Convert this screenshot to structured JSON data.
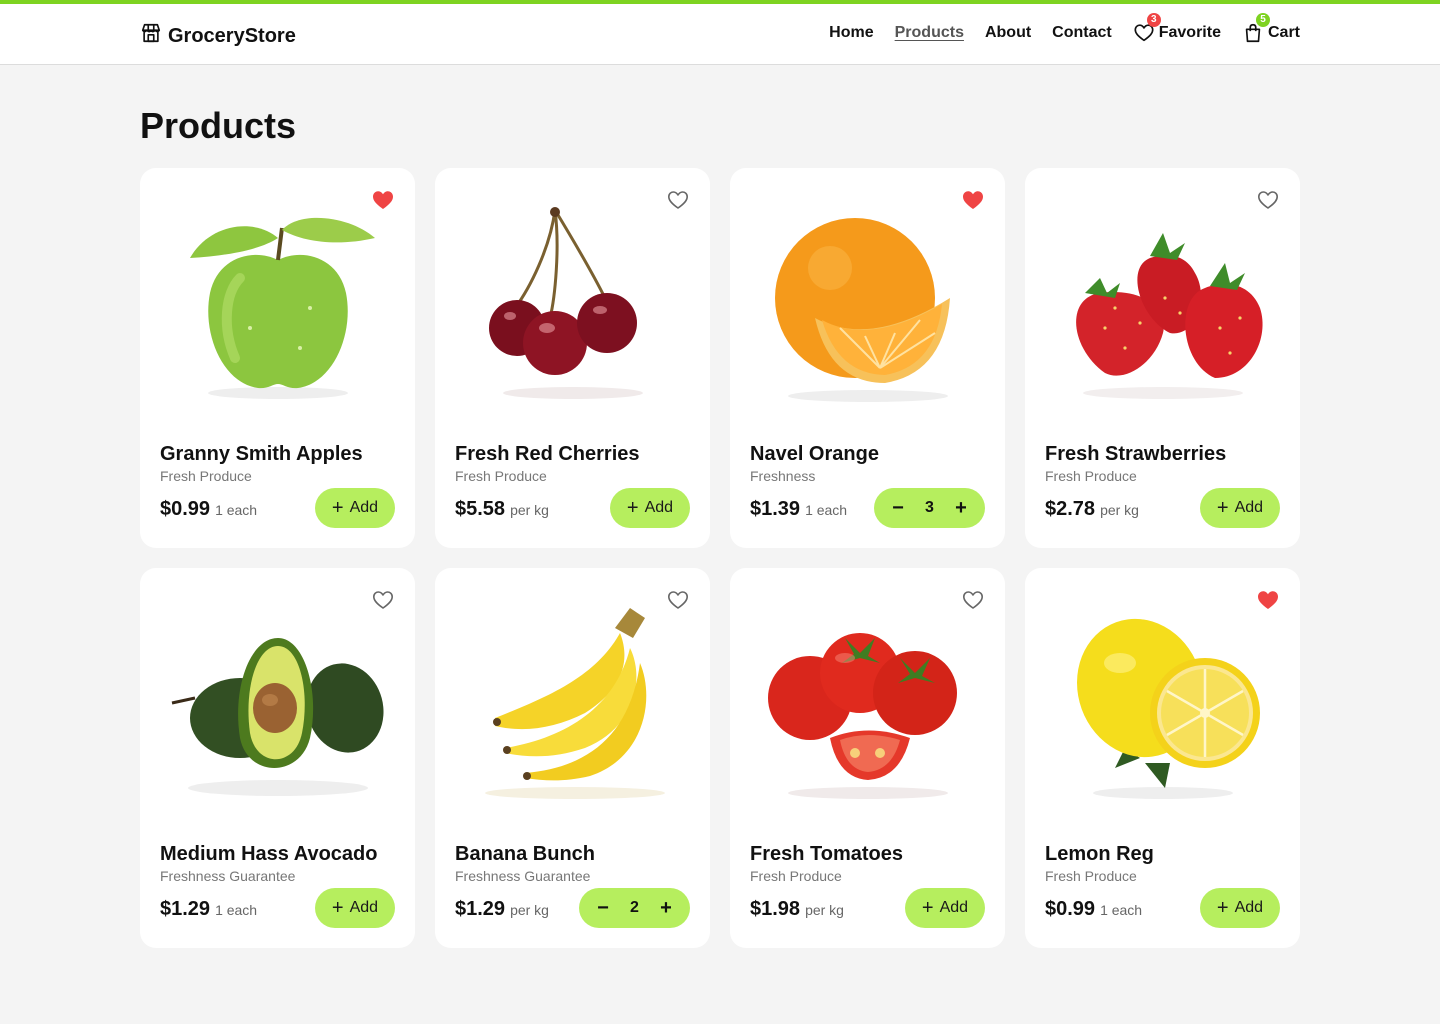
{
  "brand": {
    "name": "GroceryStore",
    "icon": "store-icon"
  },
  "nav": {
    "home": "Home",
    "products": "Products",
    "about": "About",
    "contact": "Contact",
    "favorite": {
      "label": "Favorite",
      "count": "3",
      "icon": "heart-icon"
    },
    "cart": {
      "label": "Cart",
      "count": "5",
      "icon": "shopping-bag-icon"
    }
  },
  "page_title": "Products",
  "colors": {
    "accent": "#7ed321",
    "button": "#b6ee5e",
    "fav_active": "#ef4444",
    "badge_red": "#ef4444"
  },
  "add_label": "Add",
  "products": [
    {
      "name": "Granny Smith Apples",
      "category": "Fresh Produce",
      "price": "$0.99",
      "unit": "1 each",
      "favorite": true,
      "qty": null,
      "image": "green-apple"
    },
    {
      "name": "Fresh Red Cherries",
      "category": "Fresh Produce",
      "price": "$5.58",
      "unit": "per kg",
      "favorite": false,
      "qty": null,
      "image": "cherries"
    },
    {
      "name": "Navel Orange",
      "category": "Freshness",
      "price": "$1.39",
      "unit": "1 each",
      "favorite": true,
      "qty": "3",
      "image": "orange"
    },
    {
      "name": "Fresh Strawberries",
      "category": "Fresh Produce",
      "price": "$2.78",
      "unit": "per kg",
      "favorite": false,
      "qty": null,
      "image": "strawberries"
    },
    {
      "name": "Medium Hass Avocado",
      "category": "Freshness Guarantee",
      "price": "$1.29",
      "unit": "1 each",
      "favorite": false,
      "qty": null,
      "image": "avocado"
    },
    {
      "name": "Banana Bunch",
      "category": "Freshness Guarantee",
      "price": "$1.29",
      "unit": "per kg",
      "favorite": false,
      "qty": "2",
      "image": "bananas"
    },
    {
      "name": "Fresh Tomatoes",
      "category": "Fresh Produce",
      "price": "$1.98",
      "unit": "per kg",
      "favorite": false,
      "qty": null,
      "image": "tomatoes"
    },
    {
      "name": "Lemon Reg",
      "category": "Fresh Produce",
      "price": "$0.99",
      "unit": "1 each",
      "favorite": true,
      "qty": null,
      "image": "lemon"
    }
  ]
}
